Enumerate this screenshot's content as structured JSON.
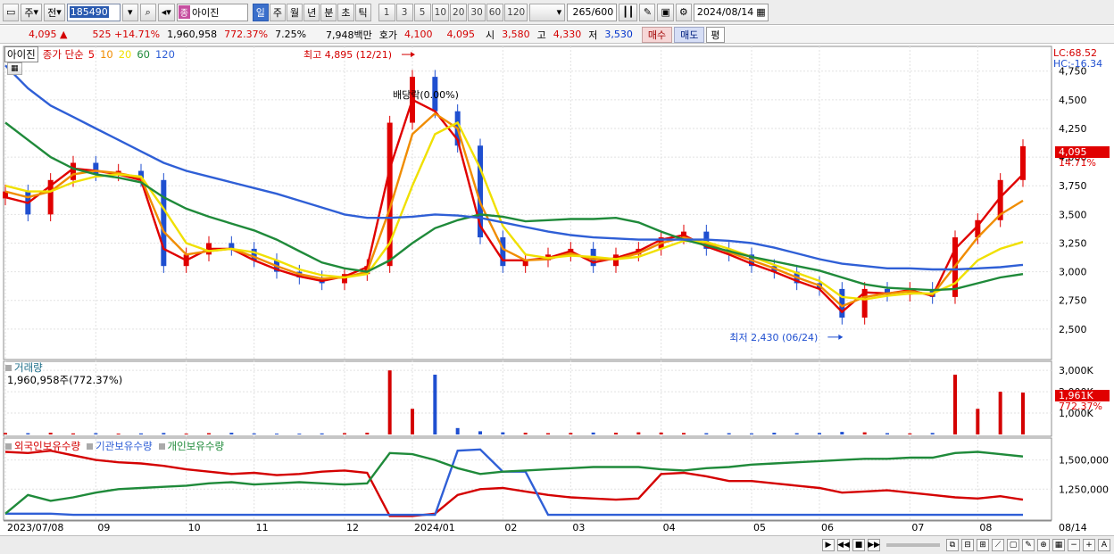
{
  "toolbar": {
    "period_main": "주",
    "prev_label": "전",
    "stock_code": "185490",
    "stock_name": "아이진",
    "name_tag": "종",
    "period_tabs": [
      {
        "label": "일",
        "active": true
      },
      {
        "label": "주",
        "active": false
      },
      {
        "label": "월",
        "active": false
      },
      {
        "label": "년",
        "active": false
      },
      {
        "label": "분",
        "active": false
      },
      {
        "label": "초",
        "active": false
      },
      {
        "label": "틱",
        "active": false
      }
    ],
    "interval_buttons": [
      "1",
      "3",
      "5",
      "10",
      "20",
      "30",
      "60",
      "120"
    ],
    "count_current": "265",
    "count_total": "/600",
    "date": "2024/08/14"
  },
  "infobar": {
    "price": "4,095",
    "change_arrow": "▲",
    "change": "525",
    "change_pct": "+14.71%",
    "volume": "1,960,958",
    "volume_ratio": "772.37%",
    "turnover": "7.25%",
    "amount": "7,948백만",
    "quote_label": "호가",
    "ask": "4,100",
    "bid": "4,095",
    "open_label": "시",
    "open": "3,580",
    "high_label": "고",
    "high": "4,330",
    "low_label": "저",
    "low": "3,530",
    "buy_label": "매수",
    "sell_label": "매도",
    "flat_label": "평"
  },
  "legend": {
    "name": "아이진",
    "series_label": "종가 단순",
    "ma": [
      {
        "period": "5",
        "color": "#e00000"
      },
      {
        "period": "10",
        "color": "#f08c00"
      },
      {
        "period": "20",
        "color": "#f0e000"
      },
      {
        "period": "60",
        "color": "#1f8a3a"
      },
      {
        "period": "120",
        "color": "#2f5fd6"
      }
    ]
  },
  "price_panel": {
    "lc": "LC:68.52",
    "hc": "HC:-16.34",
    "current_price": "4,095",
    "current_pct": "14.71%",
    "high_note": "최고 4,895 (12/21)",
    "low_note": "최저 2,430 (06/24)",
    "dividend_note": "배당락(0.00%)"
  },
  "volume_panel": {
    "title": "거래량",
    "value": "1,960,958주(772.37%)",
    "current": "1,961K",
    "current_pct": "772.37%"
  },
  "holding_panel": {
    "labels": [
      "외국인보유수량",
      "기관보유수량",
      "개인보유수량"
    ]
  },
  "x_axis": [
    "2023/07/08",
    "09",
    "10",
    "11",
    "12",
    "2024/01",
    "02",
    "03",
    "04",
    "05",
    "06",
    "07",
    "08",
    "08/14"
  ],
  "chart_data": [
    {
      "type": "candlestick",
      "title": "아이진",
      "y_ticks": [
        2500,
        2750,
        3000,
        3250,
        3500,
        3750,
        4000,
        4250,
        4500,
        4750
      ],
      "ylim": [
        2250,
        4950
      ],
      "x_ticks": [
        "2023/07/08",
        "09",
        "10",
        "11",
        "12",
        "2024/01",
        "02",
        "03",
        "04",
        "05",
        "06",
        "07",
        "08"
      ],
      "close": [
        3700,
        3500,
        3800,
        3950,
        3850,
        3880,
        3800,
        3050,
        3150,
        3250,
        3200,
        3100,
        3000,
        2950,
        2900,
        2980,
        3050,
        4300,
        4700,
        4400,
        4100,
        3300,
        3050,
        3100,
        3150,
        3200,
        3050,
        3150,
        3200,
        3300,
        3350,
        3200,
        3150,
        3050,
        3000,
        2900,
        2850,
        2600,
        2850,
        2800,
        2850,
        2780,
        3300,
        3450,
        3800,
        4095
      ],
      "series": [
        {
          "name": "5",
          "values": [
            3650,
            3600,
            3750,
            3900,
            3880,
            3850,
            3800,
            3200,
            3100,
            3200,
            3200,
            3100,
            3020,
            2960,
            2920,
            2960,
            3040,
            3900,
            4500,
            4400,
            4150,
            3400,
            3100,
            3100,
            3120,
            3180,
            3080,
            3120,
            3180,
            3280,
            3320,
            3220,
            3150,
            3070,
            3000,
            2920,
            2850,
            2650,
            2820,
            2810,
            2840,
            2790,
            3200,
            3400,
            3650,
            3850
          ]
        },
        {
          "name": "10",
          "values": [
            3700,
            3650,
            3700,
            3850,
            3880,
            3860,
            3820,
            3350,
            3150,
            3180,
            3200,
            3130,
            3050,
            2980,
            2940,
            2950,
            3000,
            3550,
            4200,
            4380,
            4250,
            3600,
            3200,
            3100,
            3110,
            3160,
            3110,
            3110,
            3160,
            3250,
            3300,
            3250,
            3170,
            3100,
            3030,
            2950,
            2880,
            2700,
            2780,
            2810,
            2830,
            2800,
            3050,
            3300,
            3500,
            3620
          ]
        },
        {
          "name": "20",
          "values": [
            3750,
            3700,
            3700,
            3780,
            3830,
            3850,
            3830,
            3550,
            3250,
            3180,
            3200,
            3170,
            3100,
            3020,
            2970,
            2950,
            2980,
            3250,
            3750,
            4200,
            4300,
            3900,
            3400,
            3150,
            3120,
            3140,
            3130,
            3110,
            3130,
            3200,
            3270,
            3260,
            3200,
            3130,
            3060,
            2990,
            2920,
            2780,
            2760,
            2790,
            2810,
            2810,
            2900,
            3100,
            3200,
            3260
          ]
        },
        {
          "name": "60",
          "values": [
            4300,
            4150,
            4000,
            3900,
            3850,
            3820,
            3780,
            3650,
            3550,
            3480,
            3420,
            3360,
            3280,
            3180,
            3080,
            3030,
            3000,
            3100,
            3250,
            3380,
            3450,
            3500,
            3480,
            3440,
            3450,
            3460,
            3460,
            3470,
            3430,
            3350,
            3280,
            3230,
            3180,
            3130,
            3090,
            3050,
            3010,
            2950,
            2890,
            2860,
            2850,
            2840,
            2850,
            2900,
            2950,
            2980
          ]
        },
        {
          "name": "120",
          "values": [
            4800,
            4600,
            4450,
            4350,
            4250,
            4150,
            4050,
            3950,
            3880,
            3830,
            3780,
            3730,
            3680,
            3620,
            3560,
            3500,
            3470,
            3470,
            3480,
            3500,
            3490,
            3470,
            3430,
            3390,
            3350,
            3320,
            3300,
            3290,
            3280,
            3280,
            3280,
            3280,
            3270,
            3250,
            3210,
            3160,
            3110,
            3070,
            3050,
            3030,
            3030,
            3020,
            3020,
            3030,
            3040,
            3060
          ]
        }
      ]
    },
    {
      "type": "bar",
      "title": "거래량",
      "y_ticks": [
        "1,000K",
        "2,000K",
        "3,000K"
      ],
      "ylim": [
        0,
        3300
      ],
      "values": [
        70,
        60,
        80,
        50,
        60,
        40,
        50,
        70,
        40,
        60,
        80,
        50,
        40,
        40,
        50,
        60,
        80,
        3000,
        1200,
        2800,
        300,
        150,
        100,
        80,
        60,
        70,
        90,
        80,
        100,
        90,
        70,
        60,
        60,
        50,
        80,
        60,
        70,
        120,
        100,
        60,
        50,
        70,
        2800,
        1200,
        2000,
        1961
      ]
    },
    {
      "type": "line",
      "title": "외국인보유수량 / 기관보유수량 / 개인보유수량",
      "y_ticks": [
        "1,250,000",
        "1,500,000"
      ],
      "ylim": [
        1000000,
        1650000
      ],
      "series": [
        {
          "name": "외국인보유수량",
          "values": [
            1570000,
            1560000,
            1580000,
            1540000,
            1500000,
            1480000,
            1470000,
            1450000,
            1420000,
            1400000,
            1380000,
            1390000,
            1370000,
            1380000,
            1400000,
            1410000,
            1390000,
            1020000,
            1020000,
            1040000,
            1200000,
            1250000,
            1260000,
            1230000,
            1200000,
            1180000,
            1170000,
            1160000,
            1170000,
            1380000,
            1390000,
            1360000,
            1320000,
            1320000,
            1300000,
            1280000,
            1260000,
            1220000,
            1230000,
            1240000,
            1220000,
            1200000,
            1180000,
            1170000,
            1190000,
            1160000
          ]
        },
        {
          "name": "기관보유수량",
          "values": [
            1040000,
            1040000,
            1040000,
            1030000,
            1030000,
            1030000,
            1030000,
            1030000,
            1030000,
            1030000,
            1030000,
            1030000,
            1030000,
            1030000,
            1030000,
            1030000,
            1030000,
            1030000,
            1030000,
            1030000,
            1580000,
            1590000,
            1400000,
            1400000,
            1030000,
            1030000,
            1030000,
            1030000,
            1030000,
            1030000,
            1030000,
            1030000,
            1030000,
            1030000,
            1030000,
            1030000,
            1030000,
            1030000,
            1030000,
            1030000,
            1030000,
            1030000,
            1030000,
            1030000,
            1030000,
            1030000
          ]
        },
        {
          "name": "개인보유수량",
          "values": [
            1040000,
            1200000,
            1150000,
            1180000,
            1220000,
            1250000,
            1260000,
            1270000,
            1280000,
            1300000,
            1310000,
            1290000,
            1300000,
            1310000,
            1300000,
            1290000,
            1300000,
            1560000,
            1550000,
            1500000,
            1430000,
            1380000,
            1400000,
            1410000,
            1420000,
            1430000,
            1440000,
            1440000,
            1440000,
            1420000,
            1410000,
            1430000,
            1440000,
            1460000,
            1470000,
            1480000,
            1490000,
            1500000,
            1510000,
            1510000,
            1520000,
            1520000,
            1560000,
            1570000,
            1550000,
            1530000
          ]
        }
      ]
    }
  ]
}
